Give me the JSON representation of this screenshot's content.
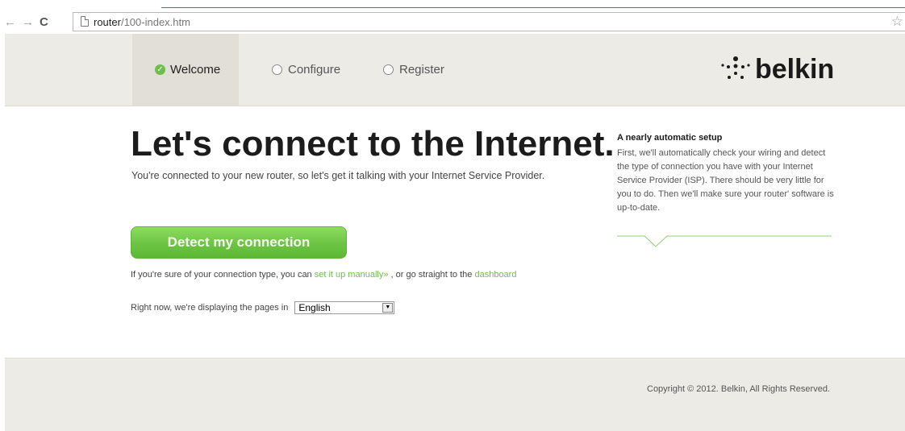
{
  "browser": {
    "url_host": "router",
    "url_path": "/100-index.htm"
  },
  "steps": [
    {
      "label": "Welcome",
      "state": "done"
    },
    {
      "label": "Configure",
      "state": "pending"
    },
    {
      "label": "Register",
      "state": "pending"
    }
  ],
  "brand": {
    "logo_text": "belkin",
    "accent_color": "#6cc04a"
  },
  "main": {
    "title": "Let's connect to the Internet.",
    "subtitle": "You're connected to your new router, so let's get it talking with your Internet Service Provider.",
    "detect_button": "Detect my connection",
    "manual_prefix": "If you're sure of your connection type, you can ",
    "manual_link": "set it up manually»",
    "manual_middle": " , or go straight to the ",
    "dashboard_link": "dashboard",
    "lang_prefix": "Right now, we're displaying the pages in",
    "language_selected": "English"
  },
  "sidebar": {
    "title": "A nearly automatic setup",
    "text": "First, we'll automatically check your wiring and detect the type of connection you have with your Internet Service Provider (ISP). There should be very little for you to do. Then we'll make sure your router' software is up-to-date."
  },
  "footer": {
    "copyright": "Copyright © 2012. Belkin, All Rights Reserved."
  }
}
